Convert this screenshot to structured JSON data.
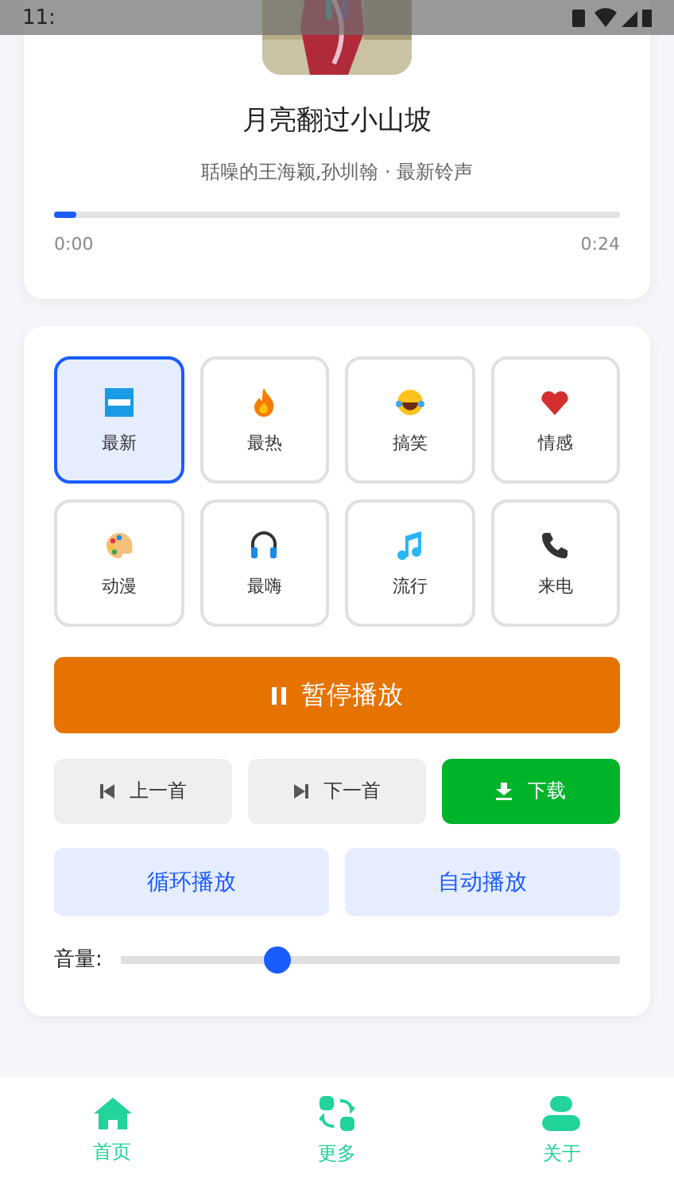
{
  "status_bar": {
    "time": "11:"
  },
  "player": {
    "title": "月亮翻过小山坡",
    "subtitle": "聒噪的王海颖,孙圳翰 · 最新铃声",
    "progress": {
      "level": 0.04,
      "elapsed": "0:00",
      "total": "0:24"
    }
  },
  "categories": [
    {
      "label": "最新",
      "kind": "new",
      "selected": true
    },
    {
      "label": "最热",
      "kind": "fire",
      "selected": false
    },
    {
      "label": "搞笑",
      "kind": "laugh",
      "selected": false
    },
    {
      "label": "情感",
      "kind": "heart",
      "selected": false
    },
    {
      "label": "动漫",
      "kind": "palette",
      "selected": false
    },
    {
      "label": "最嗨",
      "kind": "headphones",
      "selected": false
    },
    {
      "label": "流行",
      "kind": "note",
      "selected": false
    },
    {
      "label": "来电",
      "kind": "phone",
      "selected": false
    }
  ],
  "pause_button": {
    "label": "暂停播放"
  },
  "controls": [
    {
      "label": "上一首",
      "kind": "prev"
    },
    {
      "label": "下一首",
      "kind": "next"
    },
    {
      "label": "下载",
      "kind": "download"
    }
  ],
  "modes": [
    {
      "label": "循环播放"
    },
    {
      "label": "自动播放"
    }
  ],
  "volume": {
    "label": "音量:",
    "level": 0.31
  },
  "nav": [
    {
      "label": "首页",
      "kind": "home"
    },
    {
      "label": "更多",
      "kind": "switch"
    },
    {
      "label": "关于",
      "kind": "user"
    }
  ]
}
